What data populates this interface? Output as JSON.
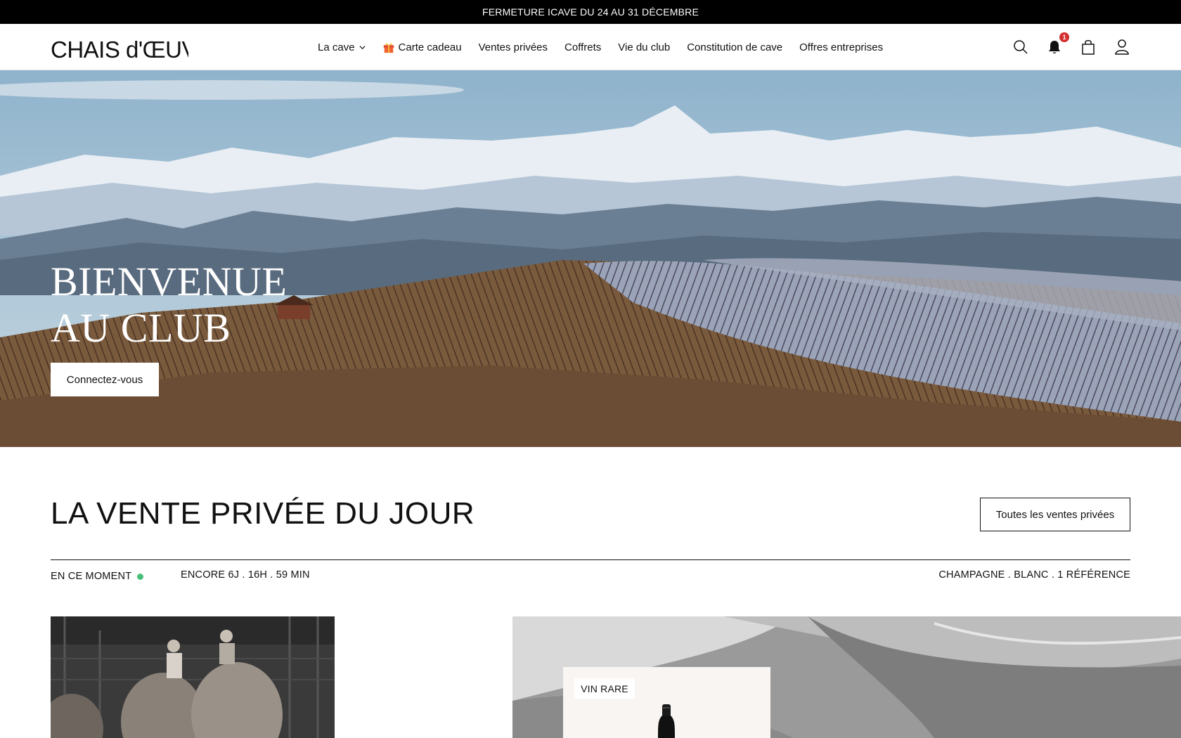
{
  "announcement": {
    "text": "FERMETURE ICAVE DU 24 AU 31 DÉCEMBRE"
  },
  "header": {
    "logo_text": "CHAIS d'ŒUVRE",
    "nav": [
      {
        "label": "La cave",
        "has_dropdown": true
      },
      {
        "label": "Carte cadeau",
        "icon": "gift-icon"
      },
      {
        "label": "Ventes privées"
      },
      {
        "label": "Coffrets"
      },
      {
        "label": "Vie du club"
      },
      {
        "label": "Constitution de cave"
      },
      {
        "label": "Offres entreprises"
      }
    ],
    "icons": [
      "search-icon",
      "bell-icon",
      "bag-icon",
      "account-icon"
    ],
    "notification_count": "1"
  },
  "hero": {
    "title_line1": "BIENVENUE",
    "title_line2": "AU CLUB",
    "cta_label": "Connectez-vous"
  },
  "private_sale": {
    "title": "LA VENTE PRIVÉE DU JOUR",
    "all_sales_label": "Toutes les ventes privées",
    "status_label": "EN CE MOMENT",
    "timer": "ENCORE 6J . 16H . 59 MIN",
    "category": "CHAMPAGNE . BLANC . 1 RÉFÉRENCE",
    "tag": "VIN RARE"
  },
  "colors": {
    "accent_dark": "#000000",
    "live_dot": "#49c07a",
    "badge": "#d32f2f",
    "card_bg": "#f8f5f2"
  }
}
